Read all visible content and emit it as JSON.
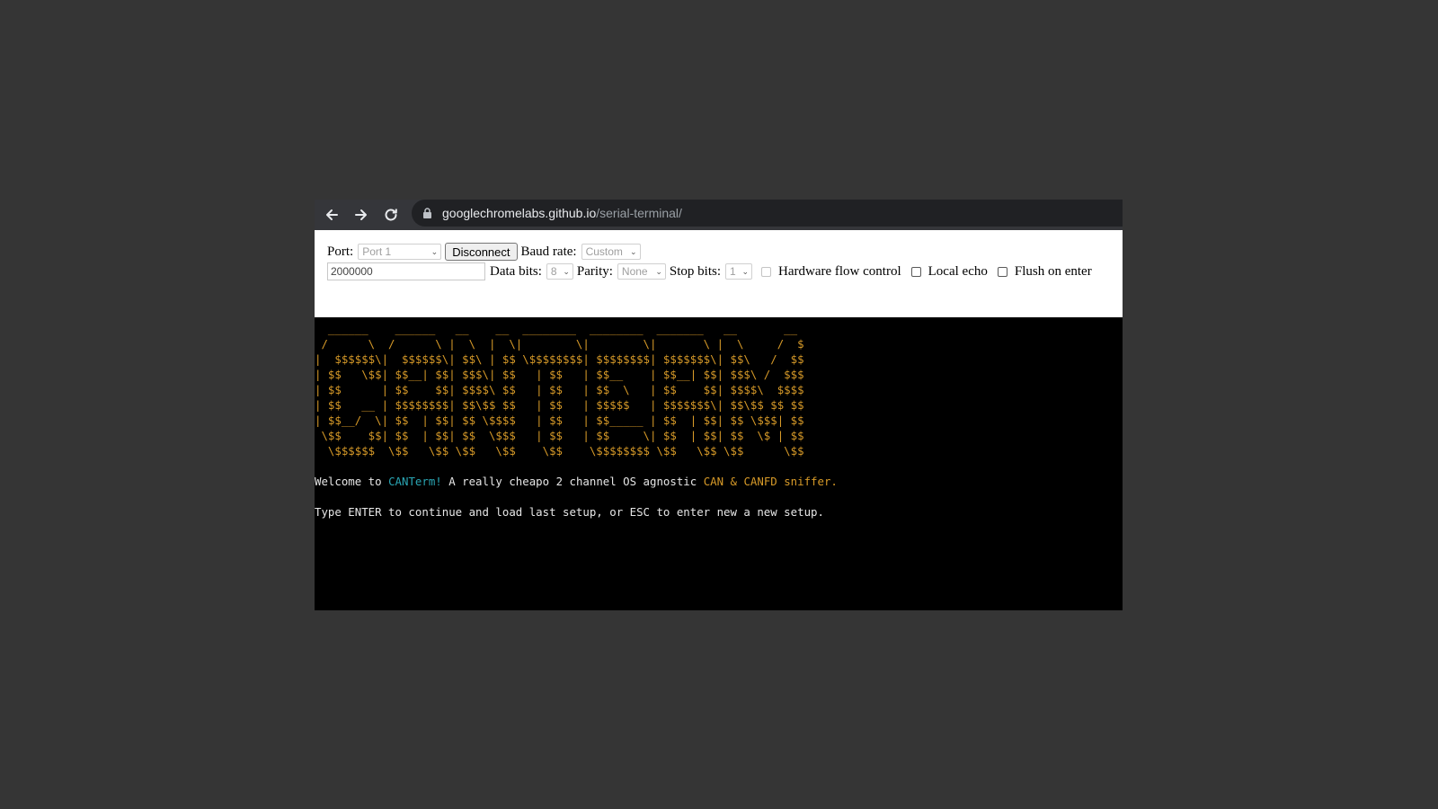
{
  "browser": {
    "url_host": "googlechromelabs.github.io",
    "url_path": "/serial-terminal/"
  },
  "controls": {
    "port_label": "Port:",
    "port_value": "Port 1",
    "disconnect_label": "Disconnect",
    "baud_label": "Baud rate:",
    "baud_value": "Custom",
    "custom_baud": "2000000",
    "databits_label": "Data bits:",
    "databits_value": "8",
    "parity_label": "Parity:",
    "parity_value": "None",
    "stopbits_label": "Stop bits:",
    "stopbits_value": "1",
    "hwflow_label": "Hardware flow control",
    "localecho_label": "Local echo",
    "flush_label": "Flush on enter"
  },
  "terminal": {
    "ascii_art": "  ______    ______   __    __  ________  ________  _______   __       __ \n /      \\  /      \\ |  \\  |  \\|        \\|        \\|       \\ |  \\     /  $\n|  $$$$$$\\|  $$$$$$\\| $$\\ | $$ \\$$$$$$$$| $$$$$$$$| $$$$$$$\\| $$\\   /  $$\n| $$   \\$$| $$__| $$| $$$\\| $$   | $$   | $$__    | $$__| $$| $$$\\ /  $$$\n| $$      | $$    $$| $$$$\\ $$   | $$   | $$  \\   | $$    $$| $$$$\\  $$$$\n| $$   __ | $$$$$$$$| $$\\$$ $$   | $$   | $$$$$   | $$$$$$$\\| $$\\$$ $$ $$\n| $$__/  \\| $$  | $$| $$ \\$$$$   | $$   | $$_____ | $$  | $$| $$ \\$$$| $$\n \\$$    $$| $$  | $$| $$  \\$$$   | $$   | $$     \\| $$  | $$| $$  \\$ | $$\n  \\$$$$$$  \\$$   \\$$ \\$$   \\$$    \\$$    \\$$$$$$$$ \\$$   \\$$ \\$$      \\$$",
    "welcome_prefix": "Welcome to ",
    "welcome_app": "CANTerm!",
    "welcome_middle": " A really cheapo 2 channel OS agnostic ",
    "welcome_suffix": "CAN & CANFD sniffer.",
    "prompt": "Type ENTER to continue and load last setup, or ESC to enter new a new setup."
  },
  "colors": {
    "background": "#353535",
    "terminal_bg": "#000000",
    "terminal_text": "#e6e6e6",
    "accent_orange": "#d79a28",
    "accent_cyan": "#2aa6b4"
  }
}
